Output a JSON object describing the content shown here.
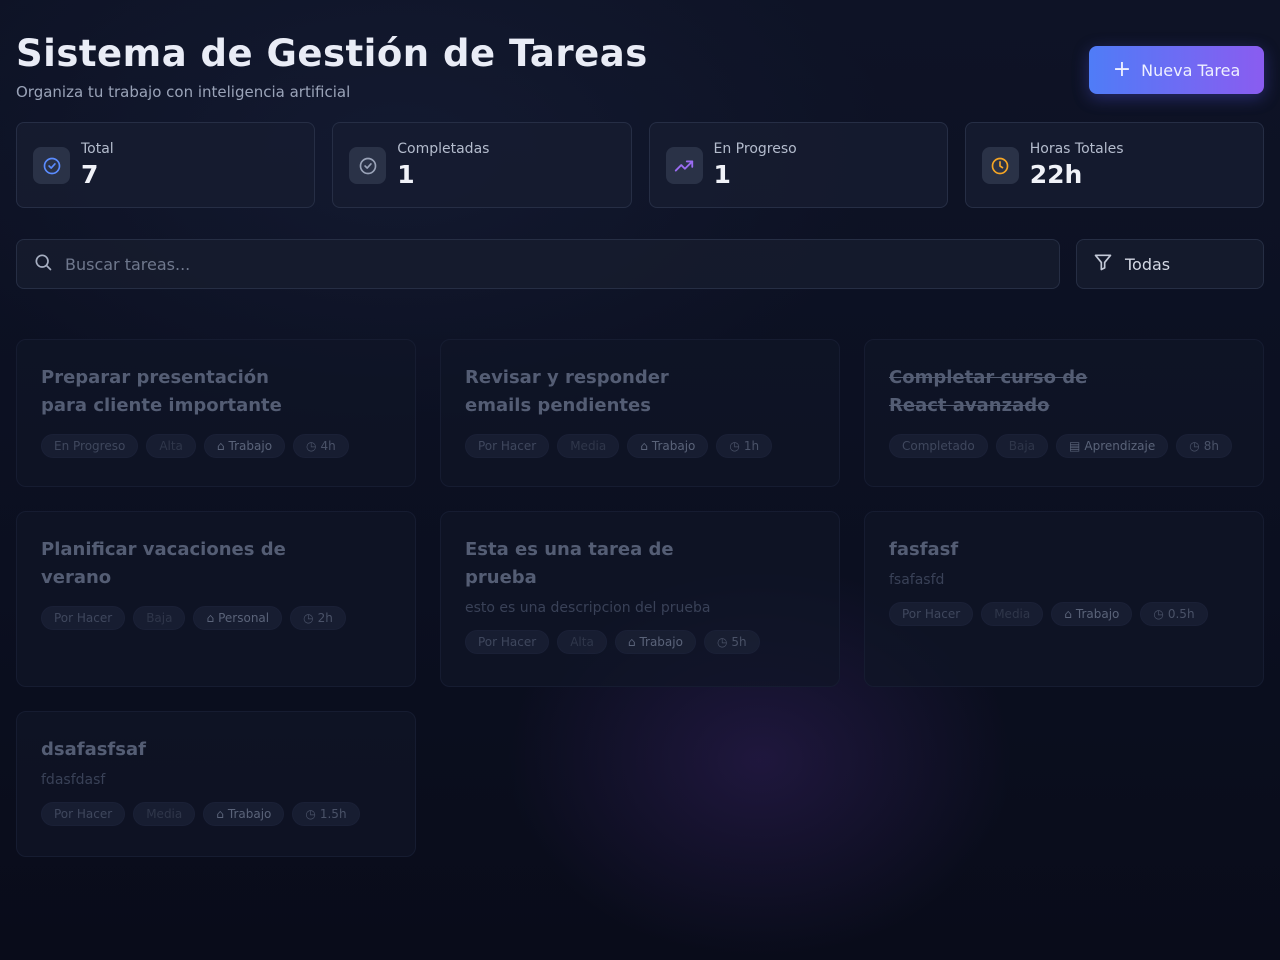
{
  "header": {
    "title": "Sistema de Gestión de Tareas",
    "subtitle": "Organiza tu trabajo con inteligencia artificial",
    "new_task_label": "Nueva Tarea"
  },
  "stats": [
    {
      "label": "Total",
      "value": "7",
      "icon": "check-circle-icon",
      "color": "#5b8cff"
    },
    {
      "label": "Completadas",
      "value": "1",
      "icon": "check-circle-icon",
      "color": "#9aa3b8"
    },
    {
      "label": "En Progreso",
      "value": "1",
      "icon": "trending-up-icon",
      "color": "#9b6cf2"
    },
    {
      "label": "Horas Totales",
      "value": "22h",
      "icon": "clock-icon",
      "color": "#f5a524"
    }
  ],
  "search": {
    "placeholder": "Buscar tareas...",
    "value": ""
  },
  "filter": {
    "selected": "Todas"
  },
  "tasks": [
    {
      "title_line1": "Preparar presentación",
      "title_line2": "para cliente importante",
      "description": "",
      "status": "En Progreso",
      "priority": "Alta",
      "category": "Trabajo",
      "hours": "4h",
      "completed": false
    },
    {
      "title_line1": "Revisar y responder",
      "title_line2": "emails pendientes",
      "description": "",
      "status": "Por Hacer",
      "priority": "Media",
      "category": "Trabajo",
      "hours": "1h",
      "completed": false
    },
    {
      "title_line1": "Completar curso de",
      "title_line2": "React avanzado",
      "description": "",
      "status": "Completado",
      "priority": "Baja",
      "category": "Aprendizaje",
      "hours": "8h",
      "completed": true
    },
    {
      "title_line1": "Planificar vacaciones de",
      "title_line2": "verano",
      "description": "",
      "status": "Por Hacer",
      "priority": "Baja",
      "category": "Personal",
      "hours": "2h",
      "completed": false
    },
    {
      "title_line1": "Esta es una tarea de",
      "title_line2": "prueba",
      "description": "esto es una descripcion del prueba",
      "status": "Por Hacer",
      "priority": "Alta",
      "category": "Trabajo",
      "hours": "5h",
      "completed": false
    },
    {
      "title_line1": "fasfasf",
      "title_line2": "",
      "description": "fsafasfd",
      "status": "Por Hacer",
      "priority": "Media",
      "category": "Trabajo",
      "hours": "0.5h",
      "completed": false
    },
    {
      "title_line1": "dsafasfsaf",
      "title_line2": "",
      "description": "fdasfdasf",
      "status": "Por Hacer",
      "priority": "Media",
      "category": "Trabajo",
      "hours": "1.5h",
      "completed": false
    }
  ]
}
